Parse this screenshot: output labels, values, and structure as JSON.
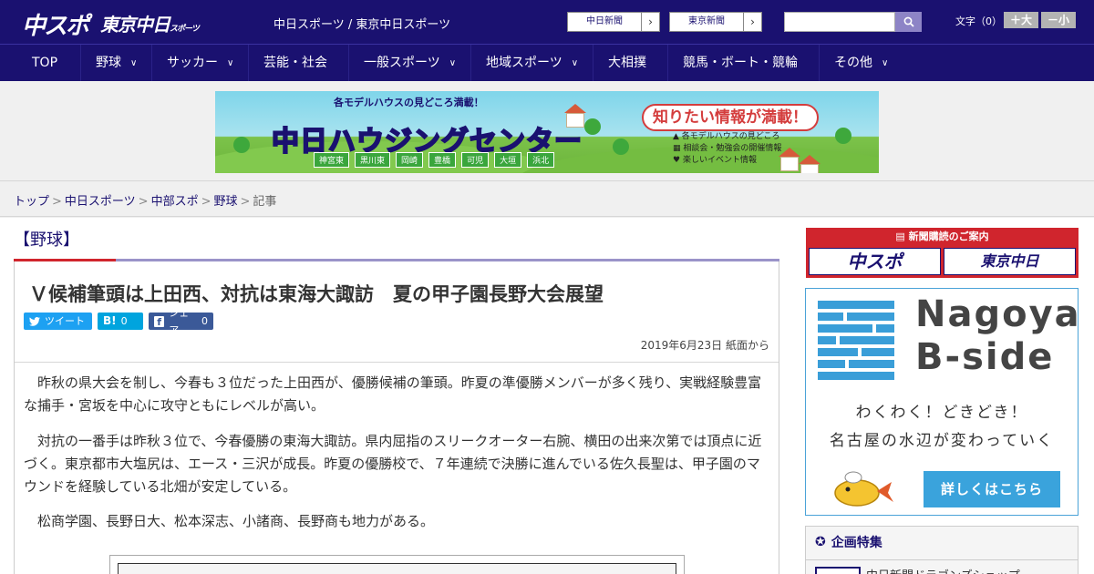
{
  "header": {
    "logo_main": "中スポ",
    "logo_tokyo": "東京中日",
    "logo_tokyo_small": "スポーツ",
    "site_names": "中日スポーツ / 東京中日スポーツ",
    "paper_links": [
      {
        "label": "中日新聞"
      },
      {
        "label": "東京新聞"
      }
    ],
    "search_placeholder": "",
    "font_size_label": "文字（0）",
    "font_larger": "＋大",
    "font_smaller": "－小"
  },
  "nav": {
    "items": [
      {
        "label": "TOP",
        "dropdown": false
      },
      {
        "label": "野球",
        "dropdown": true
      },
      {
        "label": "サッカー",
        "dropdown": true
      },
      {
        "label": "芸能・社会",
        "dropdown": false
      },
      {
        "label": "一般スポーツ",
        "dropdown": true
      },
      {
        "label": "地域スポーツ",
        "dropdown": true
      },
      {
        "label": "大相撲",
        "dropdown": false
      },
      {
        "label": "競馬・ボート・競輪",
        "dropdown": false
      },
      {
        "label": "その他",
        "dropdown": true
      }
    ]
  },
  "banner": {
    "subtitle": "各モデルハウスの見どころ満載！",
    "title": "中日ハウジングセンター",
    "cities": [
      "神宮東",
      "黒川東",
      "岡崎",
      "豊橋",
      "可児",
      "大垣",
      "浜北"
    ],
    "bubble": "知りたい情報が満載！",
    "points": [
      "各モデルハウスの見どころ",
      "相談会・勉強会の開催情報",
      "楽しいイベント情報"
    ]
  },
  "breadcrumb": {
    "items": [
      "トップ",
      "中日スポーツ",
      "中部スポ",
      "野球"
    ],
    "current": "記事",
    "separator": ">"
  },
  "article": {
    "category": "【野球】",
    "headline": "Ｖ候補筆頭は上田西、対抗は東海大諏訪　夏の甲子園長野大会展望",
    "share": {
      "tweet": "ツイート",
      "hatena_label": "B!",
      "hatena_count": "0",
      "facebook_label": "シェア",
      "facebook_count": "0"
    },
    "date": "2019年6月23日 紙面から",
    "paragraphs": [
      "昨秋の県大会を制し、今春も３位だった上田西が、優勝候補の筆頭。昨夏の準優勝メンバーが多く残り、実戦経験豊富な捕手・宮坂を中心に攻守ともにレベルが高い。",
      "対抗の一番手は昨秋３位で、今春優勝の東海大諏訪。県内屈指のスリークオーター右腕、横田の出来次第では頂点に近づく。東京都市大塩尻は、エース・三沢が成長。昨夏の優勝校で、７年連続で決勝に進んでいる佐久長聖は、甲子園のマウンドを経験している北畑が安定している。",
      "松商学園、長野日大、松本深志、小諸商、長野商も地力がある。"
    ]
  },
  "sidebar": {
    "subscription_title": "新聞購読のご案内",
    "subscription_logos": [
      "中スポ",
      "東京中日"
    ],
    "bside_title_1": "Nagoya",
    "bside_title_2": "B-side",
    "bside_line_1": "わくわく！どきどき！",
    "bside_line_2": "名古屋の水辺が変わっていく",
    "bside_button": "詳しくはこちら",
    "tokushu_title": "企画特集",
    "tokushu_item": "中日新聞ドラゴンズショップ"
  },
  "colors": {
    "brand_navy": "#1a1170",
    "accent_red": "#d0252d",
    "twitter": "#1da1f2",
    "hatena": "#00a4de",
    "facebook": "#3b5998",
    "bside_blue": "#3aa3dc"
  }
}
